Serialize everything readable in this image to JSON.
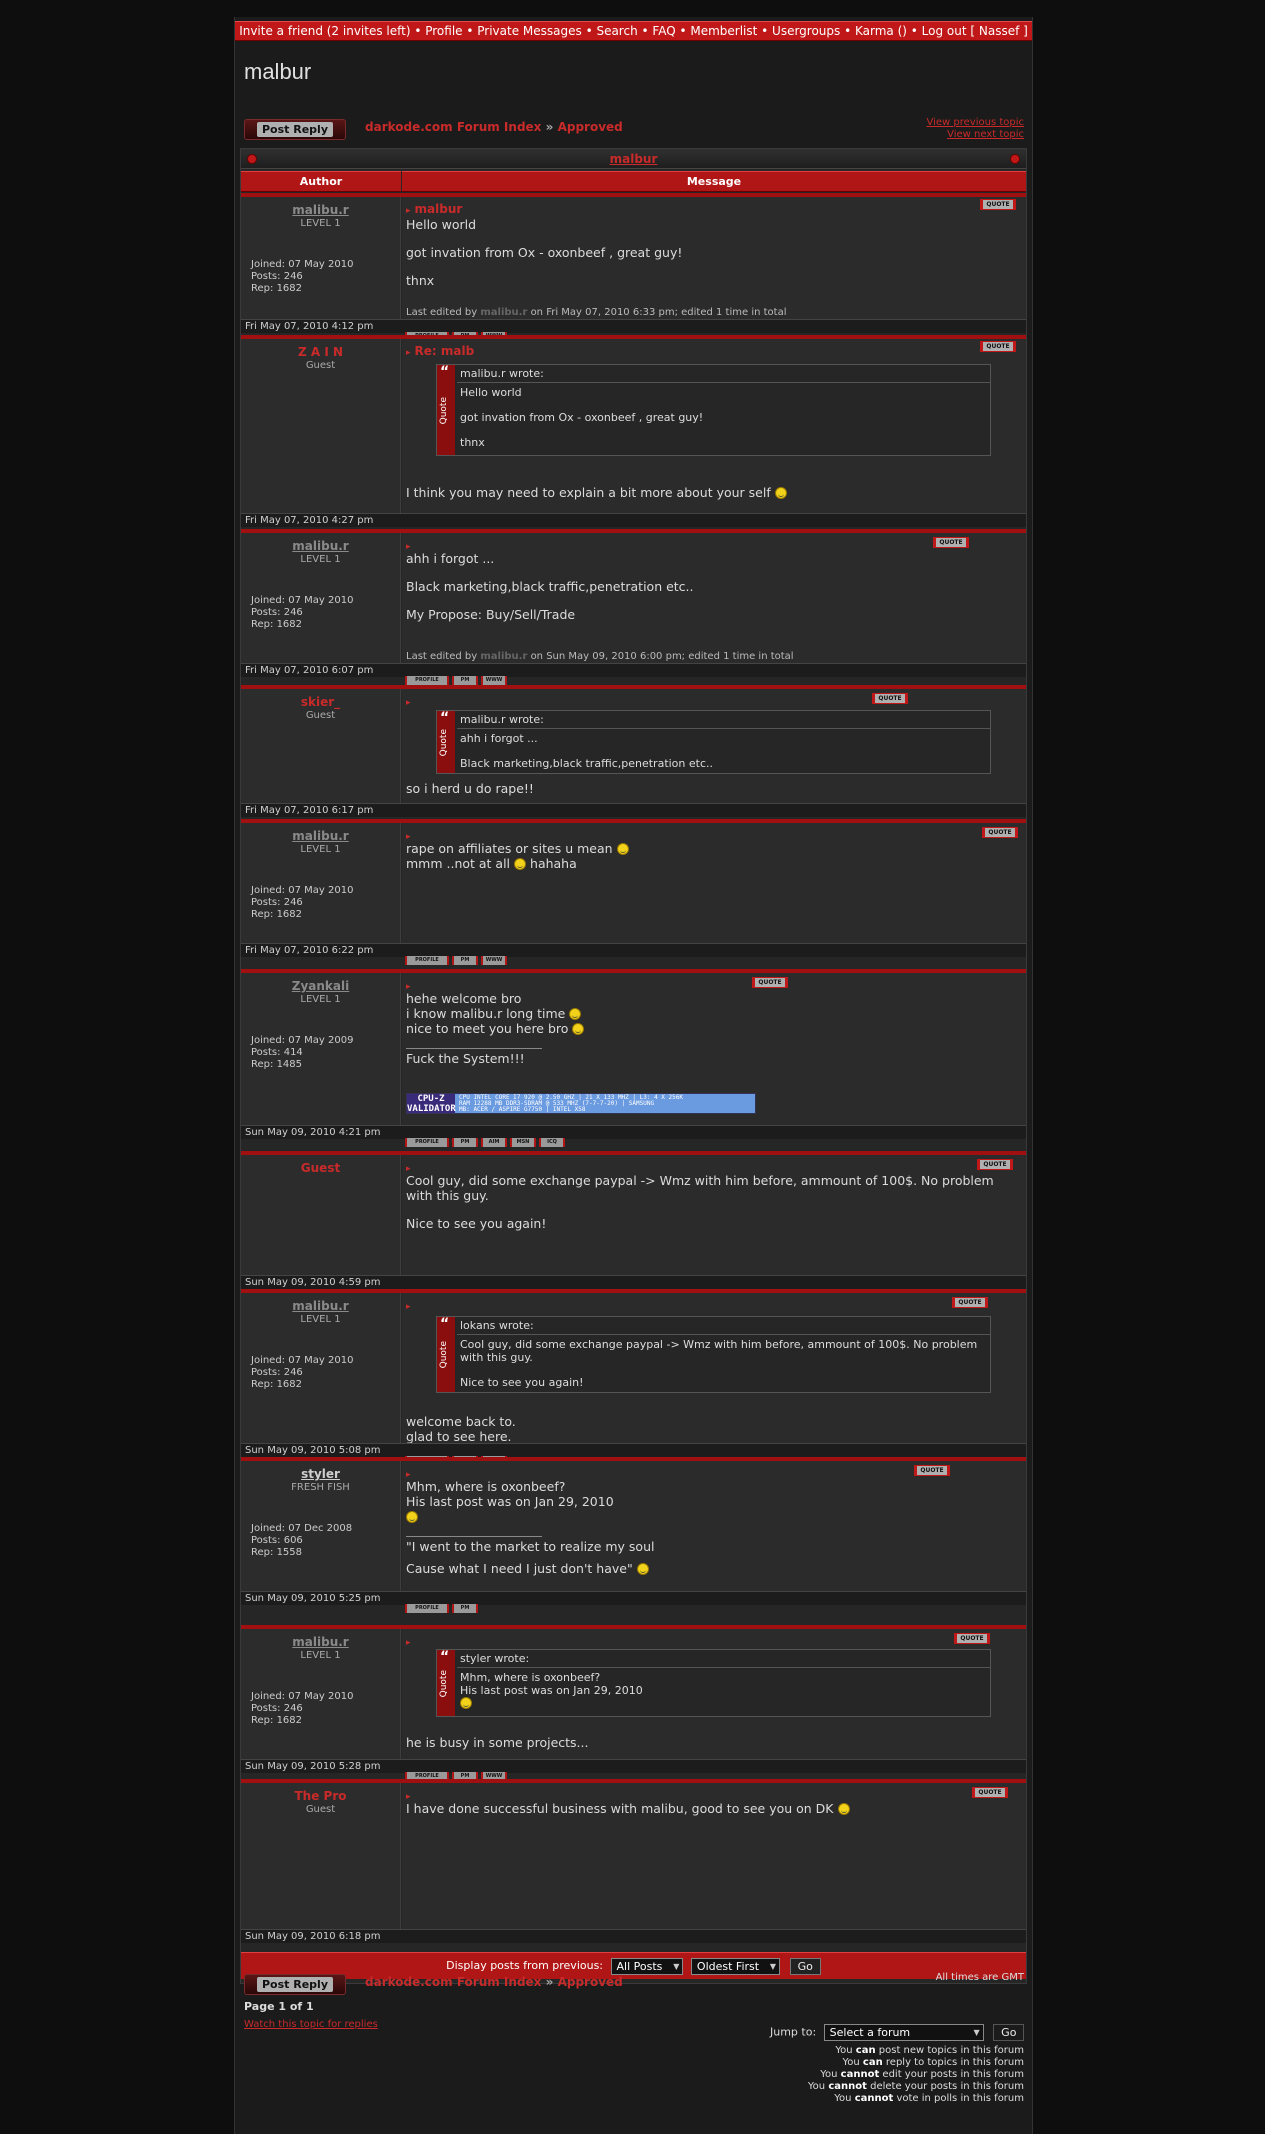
{
  "nav": {
    "text": "Invite a friend (2 invites left) • Profile • Private Messages • Search • FAQ • Memberlist • Usergroups • Karma () • Log out [ Nassef ]"
  },
  "page_title": "malbur",
  "post_reply": "Post Reply",
  "breadcrumb": {
    "forum": "darkode.com Forum Index",
    "sep": "»",
    "sub": "Approved"
  },
  "nav_prev": "View previous topic",
  "nav_next": "View next topic",
  "topic_title": "malbur",
  "cols": {
    "author": "Author",
    "message": "Message"
  },
  "labels": {
    "joined": "Joined:",
    "posts": "Posts:",
    "rep": "Rep:",
    "quote_btn": "QUOTE",
    "profile": "PROFILE",
    "pm": "PM",
    "www": "WWW",
    "aim": "AIM",
    "msn": "MSN",
    "icq": "ICQ",
    "wrote": "wrote:",
    "quote_label": "Quote"
  },
  "posts": [
    {
      "author": "malibu.r",
      "rank": "LEVEL 1",
      "joined": "07 May 2010",
      "posts": "246",
      "rep": "1682",
      "title": "malbur",
      "body": [
        "Hello world",
        "got invation from Ox - oxonbeef , great guy!",
        "thnx"
      ],
      "edited_prefix": "Last edited by",
      "edited_name": "malibu.r",
      "edited_suffix": "on Fri May 07, 2010 6:33 pm; edited 1 time in total",
      "date": "Fri May 07, 2010 4:12 pm"
    },
    {
      "author": "Z A I N",
      "rank": "Guest",
      "title": "Re: malb",
      "quote_author": "malibu.r",
      "quote_body": [
        "Hello world",
        "got invation from Ox - oxonbeef , great guy!",
        "thnx"
      ],
      "body": "I think you may need to explain a bit more about your self",
      "date": "Fri May 07, 2010 4:27 pm"
    },
    {
      "author": "malibu.r",
      "rank": "LEVEL 1",
      "joined": "07 May 2010",
      "posts": "246",
      "rep": "1682",
      "body": [
        "ahh i forgot ...",
        "Black marketing,black traffic,penetration etc..",
        "My Propose: Buy/Sell/Trade"
      ],
      "edited_prefix": "Last edited by",
      "edited_name": "malibu.r",
      "edited_suffix": "on Sun May 09, 2010 6:00 pm; edited 1 time in total",
      "date": "Fri May 07, 2010 6:07 pm"
    },
    {
      "author": "skier_",
      "rank": "Guest",
      "quote_author": "malibu.r",
      "quote_body": [
        "ahh i forgot ...",
        "Black marketing,black traffic,penetration etc.."
      ],
      "body": "so i herd u do rape!!",
      "date": "Fri May 07, 2010 6:17 pm"
    },
    {
      "author": "malibu.r",
      "rank": "LEVEL 1",
      "joined": "07 May 2010",
      "posts": "246",
      "rep": "1682",
      "body1": "rape on affiliates or sites u mean",
      "body2": "mmm ..not at all",
      "body2b": "hahaha",
      "date": "Fri May 07, 2010 6:22 pm"
    },
    {
      "author": "Zyankali",
      "rank": "LEVEL 1",
      "joined": "07 May 2009",
      "posts": "414",
      "rep": "1485",
      "body": [
        "hehe welcome bro",
        "i know malibu.r long time",
        "nice to meet you here bro"
      ],
      "sig": "Fuck the System!!!",
      "cpuz_logo": "CPU-Z VALIDATOR",
      "cpuz_l1": "CPU INTEL CORE I7 920 @ 2.50 GHZ | 21 X 133 MHZ | L3: 4 X 256K",
      "cpuz_l2": "RAM 12288 MB DDR3-SDRAM @ 533 MHZ (7-7-7-20) | SAMSUNG",
      "cpuz_l3": "MB: ACER / ASPIRE G7750 | INTEL X58",
      "date": "Sun May 09, 2010 4:21 pm"
    },
    {
      "author": "Guest",
      "body": [
        "Cool guy, did some exchange paypal -> Wmz with him before, ammount of 100$. No problem with this guy.",
        "Nice to see you again!"
      ],
      "date": "Sun May 09, 2010 4:59 pm"
    },
    {
      "author": "malibu.r",
      "rank": "LEVEL 1",
      "joined": "07 May 2010",
      "posts": "246",
      "rep": "1682",
      "quote_author": "lokans",
      "quote_body": [
        "Cool guy, did some exchange paypal -> Wmz with him before, ammount of 100$. No problem with this guy.",
        "Nice to see you again!"
      ],
      "body": [
        "welcome back to.",
        "glad to see here."
      ],
      "date": "Sun May 09, 2010 5:08 pm"
    },
    {
      "author": "styler",
      "rank": "FRESH FISH",
      "joined": "07 Dec 2008",
      "posts": "606",
      "rep": "1558",
      "body": [
        "Mhm, where is oxonbeef?",
        "His last post was on Jan 29, 2010"
      ],
      "sig1": "\"I went to the market to realize my soul",
      "sig2": "Cause what I need I just don't have\"",
      "date": "Sun May 09, 2010 5:25 pm"
    },
    {
      "author": "malibu.r",
      "rank": "LEVEL 1",
      "joined": "07 May 2010",
      "posts": "246",
      "rep": "1682",
      "quote_author": "styler",
      "quote_body": [
        "Mhm, where is oxonbeef?",
        "His last post was on Jan 29, 2010"
      ],
      "body": "he is busy in some projects...",
      "date": "Sun May 09, 2010 5:28 pm"
    },
    {
      "author": "The Pro",
      "rank": "Guest",
      "body": "I have done successful business with malibu, good to see you on DK",
      "date": "Sun May 09, 2010 6:18 pm"
    }
  ],
  "display": {
    "label": "Display posts from previous:",
    "posts_opt": "All Posts",
    "order_opt": "Oldest First",
    "go": "Go"
  },
  "times": "All times are GMT",
  "page": "Page 1 of 1",
  "watch": "Watch this topic for replies",
  "jump": {
    "label": "Jump to:",
    "value": "Select a forum",
    "go": "Go"
  },
  "perms": [
    {
      "a": "You",
      "b": "can",
      "c": "post new topics in this forum"
    },
    {
      "a": "You",
      "b": "can",
      "c": "reply to topics in this forum"
    },
    {
      "a": "You",
      "b": "cannot",
      "c": "edit your posts in this forum"
    },
    {
      "a": "You",
      "b": "cannot",
      "c": "delete your posts in this forum"
    },
    {
      "a": "You",
      "b": "cannot",
      "c": "vote in polls in this forum"
    }
  ]
}
